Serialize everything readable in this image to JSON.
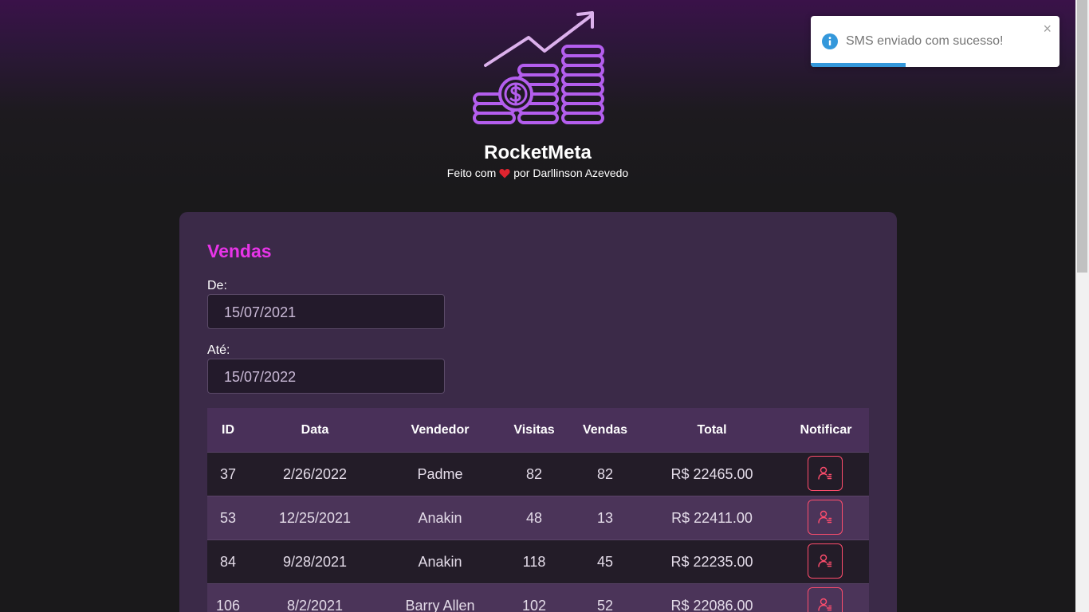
{
  "header": {
    "brand": "RocketMeta",
    "byline_before": "Feito com",
    "byline_after": "por Darllinson Azevedo"
  },
  "sales": {
    "title": "Vendas",
    "from_label": "De:",
    "from_value": "15/07/2021",
    "to_label": "Até:",
    "to_value": "15/07/2022",
    "columns": [
      "ID",
      "Data",
      "Vendedor",
      "Visitas",
      "Vendas",
      "Total",
      "Notificar"
    ],
    "rows": [
      {
        "id": "37",
        "date": "2/26/2022",
        "seller": "Padme",
        "visits": "82",
        "deals": "82",
        "total": "R$ 22465.00"
      },
      {
        "id": "53",
        "date": "12/25/2021",
        "seller": "Anakin",
        "visits": "48",
        "deals": "13",
        "total": "R$ 22411.00"
      },
      {
        "id": "84",
        "date": "9/28/2021",
        "seller": "Anakin",
        "visits": "118",
        "deals": "45",
        "total": "R$ 22235.00"
      },
      {
        "id": "106",
        "date": "8/2/2021",
        "seller": "Barry Allen",
        "visits": "102",
        "deals": "52",
        "total": "R$ 22086.00"
      }
    ]
  },
  "toast": {
    "message": "SMS enviado com sucesso!",
    "close": "×",
    "progress": 0.38
  },
  "colors": {
    "accent": "#e834e8",
    "notify": "#ff4d6d",
    "info": "#3498db",
    "card": "#3b2a48"
  },
  "icons": {
    "logo": "coins-growth-chart-icon",
    "heart": "heart-icon",
    "notify": "user-notify-icon",
    "info": "info-icon"
  }
}
